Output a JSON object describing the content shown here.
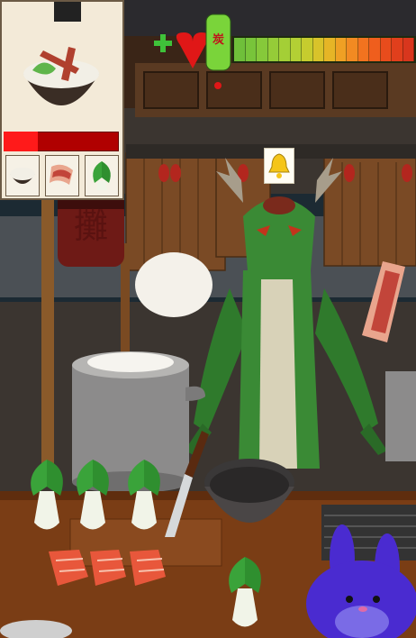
{
  "hud": {
    "lantern_glyph": "炭",
    "health_icon": "heart-plus-icon",
    "meter_segments": [
      "#6fbf3a",
      "#78c43a",
      "#86c93a",
      "#95cc38",
      "#a4cf36",
      "#b3d034",
      "#c6cc2e",
      "#d8c32a",
      "#e6b526",
      "#efa024",
      "#f28a22",
      "#f2731f",
      "#ef5e1d",
      "#e84c1c",
      "#e13f1c",
      "#d8361d"
    ],
    "bell_icon": "bell-icon"
  },
  "order": {
    "dish_icon": "rice-bowl-bacon-bokchoy-icon",
    "progress": 0.3,
    "ingredients": [
      "rice-icon",
      "bacon-icon",
      "bok-choy-icon"
    ]
  },
  "stall": {
    "banner_text": "攤"
  },
  "colors": {
    "wood": "#6b4523",
    "counter": "#7a3d15",
    "dragon_green": "#2f7a2c",
    "bunny_purple": "#4a2bd0"
  }
}
